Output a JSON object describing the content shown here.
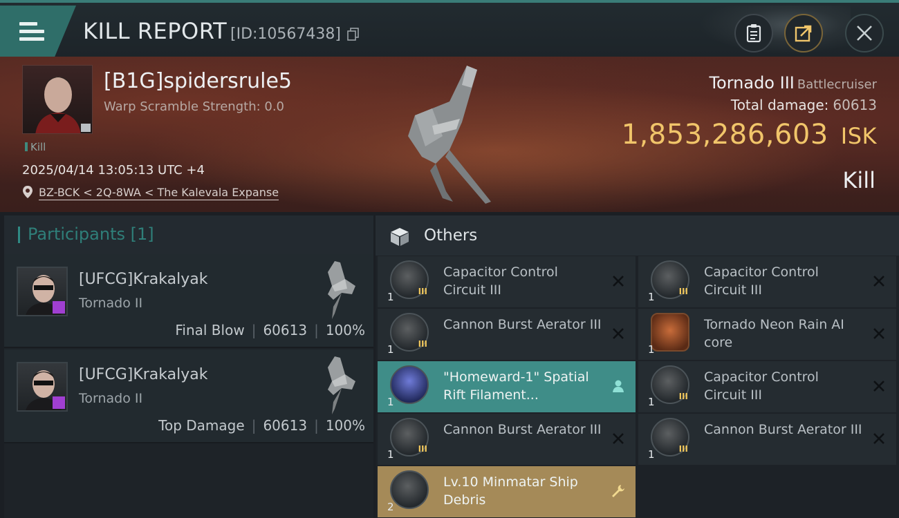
{
  "header": {
    "title": "KILL REPORT",
    "report_id": "[ID:10567438]"
  },
  "victim": {
    "name": "[B1G]spidersrule5",
    "scramble": "Warp Scramble Strength: 0.0",
    "kill_tag": "Kill",
    "datetime": "2025/04/14 13:05:13 UTC +4",
    "location": "BZ-BCK < 2Q-8WA < The Kalevala Expanse",
    "ship": "Tornado III",
    "ship_class": "Battlecruiser",
    "total_damage_label": "Total damage:",
    "total_damage": "60613",
    "isk_value": "1,853,286,603",
    "isk_unit": "ISK",
    "result": "Kill"
  },
  "participants": {
    "title": "Participants [1]",
    "rows": [
      {
        "name": "[UFCG]Krakalyak",
        "ship": "Tornado II",
        "role": "Final Blow",
        "damage": "60613",
        "percent": "100%"
      },
      {
        "name": "[UFCG]Krakalyak",
        "ship": "Tornado II",
        "role": "Top Damage",
        "damage": "60613",
        "percent": "100%"
      }
    ]
  },
  "others": {
    "title": "Others",
    "items": [
      {
        "name": "Capacitor Control Circuit III",
        "qty": "1",
        "meta": "III",
        "action": "close-icon"
      },
      {
        "name": "Capacitor Control Circuit III",
        "qty": "1",
        "meta": "III",
        "action": "close-icon"
      },
      {
        "name": "Cannon Burst Aerator III",
        "qty": "1",
        "meta": "III",
        "action": "close-icon"
      },
      {
        "name": "Tornado Neon Rain AI core",
        "qty": "1",
        "meta": "",
        "action": "close-icon"
      },
      {
        "name": "\"Homeward-1\" Spatial Rift Filament...",
        "qty": "1",
        "meta": "",
        "action": "person-icon"
      },
      {
        "name": "Capacitor Control Circuit III",
        "qty": "1",
        "meta": "III",
        "action": "close-icon"
      },
      {
        "name": "Cannon Burst Aerator III",
        "qty": "1",
        "meta": "III",
        "action": "close-icon"
      },
      {
        "name": "Cannon Burst Aerator III",
        "qty": "1",
        "meta": "III",
        "action": "close-icon"
      },
      {
        "name": "Lv.10 Minmatar Ship Debris",
        "qty": "2",
        "meta": "",
        "action": "wrench-icon"
      }
    ]
  },
  "colors": {
    "accent_teal": "#3f8d88",
    "isk_gold": "#f1c56a",
    "highlight_gold": "#a58a58"
  }
}
